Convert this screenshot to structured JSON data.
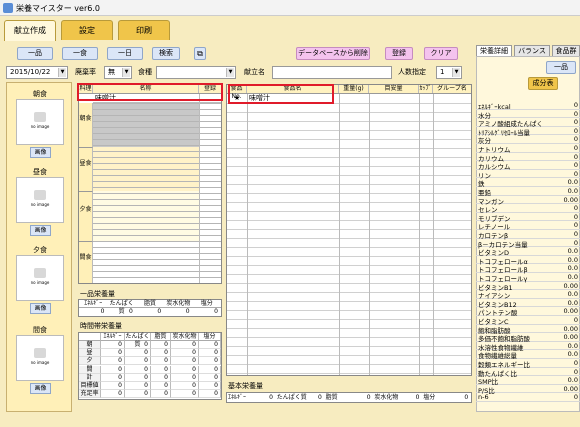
{
  "window": {
    "title": "栄養マイスター ver6.0"
  },
  "tabs": [
    {
      "label": "献立作成"
    },
    {
      "label": "設定"
    },
    {
      "label": "印刷"
    }
  ],
  "toolbar": {
    "btn_ippin": "一品",
    "btn_isshoku": "一食",
    "btn_ichinichi": "一日",
    "btn_search": "検索",
    "btn_db_delete": "データベースから削除",
    "btn_register": "登録",
    "btn_clear": "クリア",
    "date_value": "2015/10/22",
    "waste_label": "廃棄率",
    "waste_value": "無",
    "meal_type_label": "食種",
    "meal_type_value": "",
    "menu_name_label": "献立名",
    "menu_name_value": "",
    "people_label": "人数指定",
    "people_value": "1"
  },
  "meals": {
    "breakfast": "朝食",
    "lunch": "昼食",
    "dinner": "夕食",
    "snack": "間食",
    "no_image": "no image",
    "image_btn": "画像"
  },
  "menu_grid": {
    "headers": [
      "料理",
      "名称",
      "登録"
    ],
    "selected_item": "味噌汁",
    "sections": [
      "朝食",
      "昼食",
      "夕食",
      "間食"
    ]
  },
  "ingredient_grid": {
    "headers": [
      "食品No.",
      "食品名",
      "重量(g)",
      "目安量",
      "ｶｯﾌﾟ",
      "グループ名"
    ],
    "first_row_mark": "★",
    "first_row_name": "味噌汁"
  },
  "single_nutrition": {
    "title": "一品栄養量",
    "headers": [
      "ｴﾈﾙｷﾞｰ",
      "たんぱく質",
      "脂質",
      "炭水化物",
      "塩分"
    ],
    "values": [
      "0",
      "0",
      "0",
      "0",
      "0"
    ]
  },
  "time_nutrition": {
    "title": "時間帯栄養量",
    "headers": [
      "",
      "ｴﾈﾙｷﾞｰ",
      "たんぱく質",
      "脂質",
      "炭水化物",
      "塩分"
    ],
    "rows": [
      {
        "label": "朝",
        "values": [
          "0",
          "0",
          "0",
          "0",
          "0"
        ]
      },
      {
        "label": "昼",
        "values": [
          "0",
          "0",
          "0",
          "0",
          "0"
        ]
      },
      {
        "label": "夕",
        "values": [
          "0",
          "0",
          "0",
          "0",
          "0"
        ]
      },
      {
        "label": "間",
        "values": [
          "0",
          "0",
          "0",
          "0",
          "0"
        ]
      },
      {
        "label": "計",
        "values": [
          "0",
          "0",
          "0",
          "0",
          "0"
        ]
      },
      {
        "label": "目標値",
        "values": [
          "0",
          "0",
          "0",
          "0",
          "0"
        ]
      },
      {
        "label": "充足率",
        "values": [
          "0",
          "0",
          "0",
          "0",
          "0"
        ]
      }
    ]
  },
  "basic_nutrition": {
    "title": "基本栄養量",
    "items": [
      {
        "label": "ｴﾈﾙｷﾞｰ",
        "value": "0"
      },
      {
        "label": "たんぱく質",
        "value": "0"
      },
      {
        "label": "脂質",
        "value": "0"
      },
      {
        "label": "炭水化物",
        "value": "0"
      },
      {
        "label": "塩分",
        "value": "0"
      }
    ]
  },
  "nutrition_panel": {
    "tabs": [
      "栄養詳細",
      "バランス",
      "食品群"
    ],
    "btn_ippin": "一品",
    "btn_component": "成分表",
    "rows": [
      {
        "k": "ｴﾈﾙｷﾞｰkcal",
        "v": "0"
      },
      {
        "k": "水分",
        "v": "0"
      },
      {
        "k": "アミノ酸組成たんぱく",
        "v": "0"
      },
      {
        "k": "ﾄﾘｱｼﾙｸﾞﾘｾﾛｰﾙ当量",
        "v": "0"
      },
      {
        "k": "灰分",
        "v": "0"
      },
      {
        "k": "ナトリウム",
        "v": "0"
      },
      {
        "k": "カリウム",
        "v": "0"
      },
      {
        "k": "カルシウム",
        "v": "0"
      },
      {
        "k": "リン",
        "v": "0"
      },
      {
        "k": "鉄",
        "v": "0.0"
      },
      {
        "k": "亜鉛",
        "v": "0.0"
      },
      {
        "k": "マンガン",
        "v": "0.00"
      },
      {
        "k": "セレン",
        "v": "0"
      },
      {
        "k": "モリブデン",
        "v": "0"
      },
      {
        "k": "レチノール",
        "v": "0"
      },
      {
        "k": "カロテンβ",
        "v": "0"
      },
      {
        "k": "β－カロテン当量",
        "v": "0"
      },
      {
        "k": "ビタミンD",
        "v": "0.0"
      },
      {
        "k": "トコフェロールα",
        "v": "0.0"
      },
      {
        "k": "トコフェロールβ",
        "v": "0.0"
      },
      {
        "k": "トコフェロールγ",
        "v": "0.0"
      },
      {
        "k": "ビタミンB1",
        "v": "0.00"
      },
      {
        "k": "ナイアシン",
        "v": "0.0"
      },
      {
        "k": "ビタミンB12",
        "v": "0.0"
      },
      {
        "k": "パントテン酸",
        "v": "0.00"
      },
      {
        "k": "ビタミンC",
        "v": "0"
      },
      {
        "k": "飽和脂肪酸",
        "v": "0.00"
      },
      {
        "k": "多価不飽和脂肪酸",
        "v": "0.00"
      },
      {
        "k": "水溶性食物繊維",
        "v": "0.0"
      },
      {
        "k": "食物繊維総量",
        "v": "0.0"
      },
      {
        "k": "穀類エネルギー比",
        "v": "0"
      },
      {
        "k": "動たんぱく比",
        "v": "0"
      },
      {
        "k": "SMP比",
        "v": "0.0"
      },
      {
        "k": "P/S比",
        "v": "0.00"
      },
      {
        "k": "n-6",
        "v": "0"
      }
    ]
  }
}
